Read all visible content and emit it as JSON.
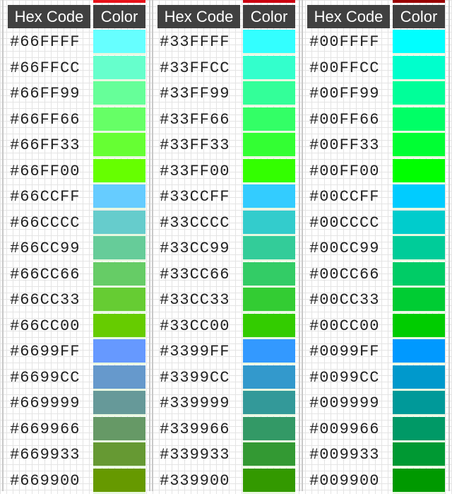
{
  "headers": {
    "hex": "Hex Code",
    "color": "Color"
  },
  "top_sliver_colors": [
    "#e8121a",
    "#cc0010",
    "#990000"
  ],
  "panels": [
    {
      "rows": [
        {
          "hex": "#66FFFF",
          "color": "#66FFFF"
        },
        {
          "hex": "#66FFCC",
          "color": "#66FFCC"
        },
        {
          "hex": "#66FF99",
          "color": "#66FF99"
        },
        {
          "hex": "#66FF66",
          "color": "#66FF66"
        },
        {
          "hex": "#66FF33",
          "color": "#66FF33"
        },
        {
          "hex": "#66FF00",
          "color": "#66FF00"
        },
        {
          "hex": "#66CCFF",
          "color": "#66CCFF"
        },
        {
          "hex": "#66CCCC",
          "color": "#66CCCC"
        },
        {
          "hex": "#66CC99",
          "color": "#66CC99"
        },
        {
          "hex": "#66CC66",
          "color": "#66CC66"
        },
        {
          "hex": "#66CC33",
          "color": "#66CC33"
        },
        {
          "hex": "#66CC00",
          "color": "#66CC00"
        },
        {
          "hex": "#6699FF",
          "color": "#6699FF"
        },
        {
          "hex": "#6699CC",
          "color": "#6699CC"
        },
        {
          "hex": "#669999",
          "color": "#669999"
        },
        {
          "hex": "#669966",
          "color": "#669966"
        },
        {
          "hex": "#669933",
          "color": "#669933"
        },
        {
          "hex": "#669900",
          "color": "#669900"
        }
      ]
    },
    {
      "rows": [
        {
          "hex": "#33FFFF",
          "color": "#33FFFF"
        },
        {
          "hex": "#33FFCC",
          "color": "#33FFCC"
        },
        {
          "hex": "#33FF99",
          "color": "#33FF99"
        },
        {
          "hex": "#33FF66",
          "color": "#33FF66"
        },
        {
          "hex": "#33FF33",
          "color": "#33FF33"
        },
        {
          "hex": "#33FF00",
          "color": "#33FF00"
        },
        {
          "hex": "#33CCFF",
          "color": "#33CCFF"
        },
        {
          "hex": "#33CCCC",
          "color": "#33CCCC"
        },
        {
          "hex": "#33CC99",
          "color": "#33CC99"
        },
        {
          "hex": "#33CC66",
          "color": "#33CC66"
        },
        {
          "hex": "#33CC33",
          "color": "#33CC33"
        },
        {
          "hex": "#33CC00",
          "color": "#33CC00"
        },
        {
          "hex": "#3399FF",
          "color": "#3399FF"
        },
        {
          "hex": "#3399CC",
          "color": "#3399CC"
        },
        {
          "hex": "#339999",
          "color": "#339999"
        },
        {
          "hex": "#339966",
          "color": "#339966"
        },
        {
          "hex": "#339933",
          "color": "#339933"
        },
        {
          "hex": "#339900",
          "color": "#339900"
        }
      ]
    },
    {
      "rows": [
        {
          "hex": "#00FFFF",
          "color": "#00FFFF"
        },
        {
          "hex": "#00FFCC",
          "color": "#00FFCC"
        },
        {
          "hex": "#00FF99",
          "color": "#00FF99"
        },
        {
          "hex": "#00FF66",
          "color": "#00FF66"
        },
        {
          "hex": "#00FF33",
          "color": "#00FF33"
        },
        {
          "hex": "#00FF00",
          "color": "#00FF00"
        },
        {
          "hex": "#00CCFF",
          "color": "#00CCFF"
        },
        {
          "hex": "#00CCCC",
          "color": "#00CCCC"
        },
        {
          "hex": "#00CC99",
          "color": "#00CC99"
        },
        {
          "hex": "#00CC66",
          "color": "#00CC66"
        },
        {
          "hex": "#00CC33",
          "color": "#00CC33"
        },
        {
          "hex": "#00CC00",
          "color": "#00CC00"
        },
        {
          "hex": "#0099FF",
          "color": "#0099FF"
        },
        {
          "hex": "#0099CC",
          "color": "#0099CC"
        },
        {
          "hex": "#009999",
          "color": "#009999"
        },
        {
          "hex": "#009966",
          "color": "#009966"
        },
        {
          "hex": "#009933",
          "color": "#009933"
        },
        {
          "hex": "#009900",
          "color": "#009900"
        }
      ]
    }
  ]
}
